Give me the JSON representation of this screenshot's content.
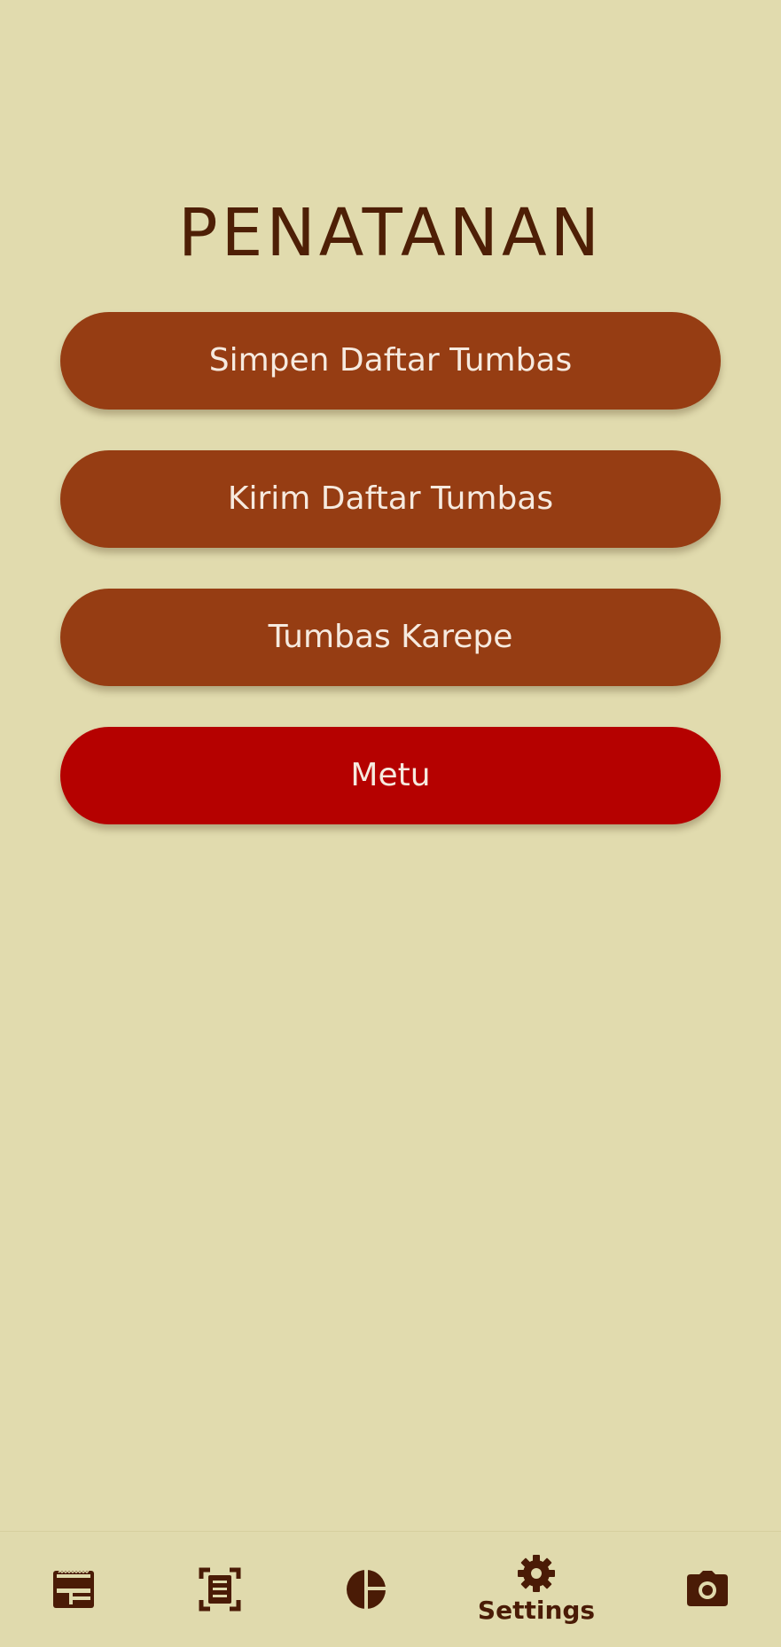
{
  "page": {
    "title": "PENATANAN"
  },
  "menu": {
    "items": [
      {
        "label": "Simpen Daftar Tumbas"
      },
      {
        "label": "Kirim Daftar Tumbas"
      },
      {
        "label": "Tumbas Karepe"
      },
      {
        "label": "Metu"
      }
    ]
  },
  "bottom_nav": {
    "items": [
      {
        "icon": "list-table-icon",
        "label": ""
      },
      {
        "icon": "document-scan-icon",
        "label": ""
      },
      {
        "icon": "pie-chart-icon",
        "label": ""
      },
      {
        "icon": "gear-icon",
        "label": "Settings",
        "active": true
      },
      {
        "icon": "camera-icon",
        "label": ""
      }
    ]
  },
  "colors": {
    "background": "#e1dbae",
    "title": "#4e1f06",
    "button": "#963d13",
    "exit_button": "#b50100",
    "button_text": "#f6eadf",
    "icon": "#4a1b06"
  }
}
